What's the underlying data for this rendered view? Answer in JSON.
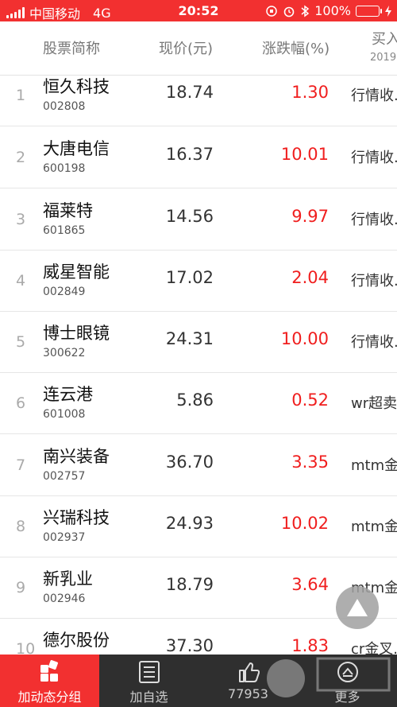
{
  "status_bar": {
    "carrier": "中国移动",
    "network": "4G",
    "time": "20:52",
    "battery": "100%"
  },
  "table_header": {
    "name": "股票简称",
    "price": "现价(元)",
    "change": "涨跌幅(%)",
    "buy": "买入",
    "buy_sub": "2019"
  },
  "rows": [
    {
      "idx": "1",
      "name": "恒久科技",
      "code": "002808",
      "price": "18.74",
      "change": "1.30",
      "buy": "行情收..."
    },
    {
      "idx": "2",
      "name": "大唐电信",
      "code": "600198",
      "price": "16.37",
      "change": "10.01",
      "buy": "行情收..."
    },
    {
      "idx": "3",
      "name": "福莱特",
      "code": "601865",
      "price": "14.56",
      "change": "9.97",
      "buy": "行情收..."
    },
    {
      "idx": "4",
      "name": "威星智能",
      "code": "002849",
      "price": "17.02",
      "change": "2.04",
      "buy": "行情收..."
    },
    {
      "idx": "5",
      "name": "博士眼镜",
      "code": "300622",
      "price": "24.31",
      "change": "10.00",
      "buy": "行情收..."
    },
    {
      "idx": "6",
      "name": "连云港",
      "code": "601008",
      "price": "5.86",
      "change": "0.52",
      "buy": "wr超卖"
    },
    {
      "idx": "7",
      "name": "南兴装备",
      "code": "002757",
      "price": "36.70",
      "change": "3.35",
      "buy": "mtm金..."
    },
    {
      "idx": "8",
      "name": "兴瑞科技",
      "code": "002937",
      "price": "24.93",
      "change": "10.02",
      "buy": "mtm金..."
    },
    {
      "idx": "9",
      "name": "新乳业",
      "code": "002946",
      "price": "18.79",
      "change": "3.64",
      "buy": "mtm金叉"
    },
    {
      "idx": "10",
      "name": "德尔股份",
      "code": "",
      "price": "37.30",
      "change": "1.83",
      "buy": "cr金叉..."
    }
  ],
  "tabbar": [
    {
      "label": "加动态分组",
      "icon": "dynamic-group-icon"
    },
    {
      "label": "加自选",
      "icon": "list-icon"
    },
    {
      "label": "77953",
      "icon": "thumbs-up-icon"
    },
    {
      "label": "更多",
      "icon": "more-icon"
    }
  ],
  "colors": {
    "accent": "#f23030",
    "up": "#f01e1e",
    "tabbar_bg": "#2f2f2f"
  }
}
